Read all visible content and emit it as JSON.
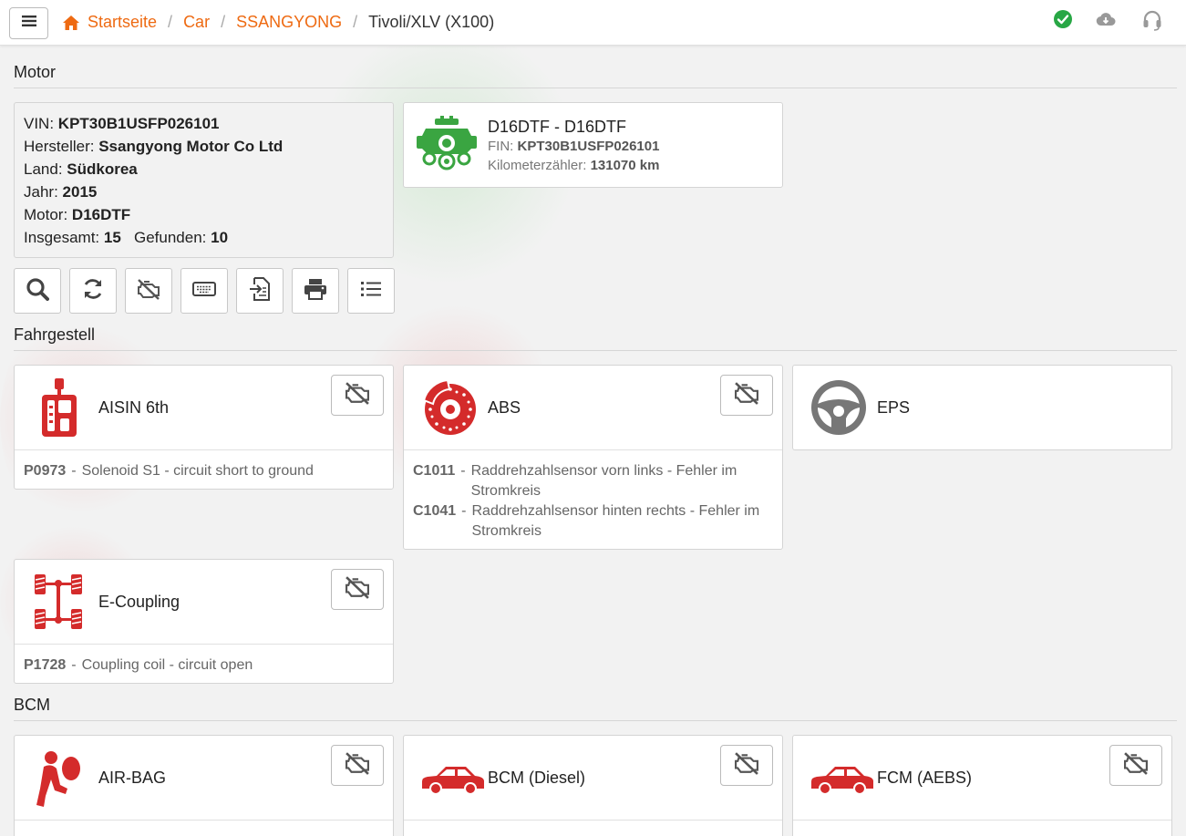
{
  "breadcrumb": {
    "home": "Startseite",
    "car": "Car",
    "brand": "SSANGYONG",
    "model": "Tivoli/XLV (X100)"
  },
  "colors": {
    "accent": "#ee6a12",
    "ok": "#28a745",
    "error": "#d42b2b",
    "engine": "#3aa541"
  },
  "icons": {
    "menu": "bars-icon",
    "home": "home-icon",
    "status": "check-circle-icon",
    "cloud": "cloud-download-icon",
    "support": "headset-icon"
  },
  "motor": {
    "title": "Motor",
    "vin_label": "VIN:",
    "vin": "KPT30B1USFP026101",
    "maker_label": "Hersteller:",
    "maker": "Ssangyong Motor Co Ltd",
    "country_label": "Land:",
    "country": "Südkorea",
    "year_label": "Jahr:",
    "year": "2015",
    "engine_label": "Motor:",
    "engine": "D16DTF",
    "total_label": "Insgesamt:",
    "total": "15",
    "found_label": "Gefunden:",
    "found": "10",
    "card": {
      "title": "D16DTF - D16DTF",
      "fin_label": "FIN:",
      "fin": "KPT30B1USFP026101",
      "km_label": "Kilometerzähler:",
      "km": "131070 km"
    },
    "tools": [
      "search-icon",
      "refresh-icon",
      "engine-off-icon",
      "keyboard-icon",
      "import-icon",
      "print-icon",
      "list-icon"
    ]
  },
  "fahrgestell": {
    "title": "Fahrgestell",
    "aisin": {
      "title": "AISIN 6th",
      "errors": [
        {
          "code": "P0973",
          "text": "Solenoid S1 - circuit short to ground"
        }
      ]
    },
    "abs": {
      "title": "ABS",
      "errors": [
        {
          "code": "C1011",
          "text": "Raddrehzahlsensor vorn links - Fehler im Stromkreis"
        },
        {
          "code": "C1041",
          "text": "Raddrehzahlsensor hinten rechts - Fehler im Stromkreis"
        }
      ]
    },
    "eps": {
      "title": "EPS"
    },
    "ecoupling": {
      "title": "E-Coupling",
      "errors": [
        {
          "code": "P1728",
          "text": "Coupling coil - circuit open"
        }
      ]
    }
  },
  "bcm": {
    "title": "BCM",
    "airbag": {
      "title": "AIR-BAG"
    },
    "bcm_diesel": {
      "title": "BCM (Diesel)"
    },
    "fcm": {
      "title": "FCM (AEBS)"
    }
  }
}
